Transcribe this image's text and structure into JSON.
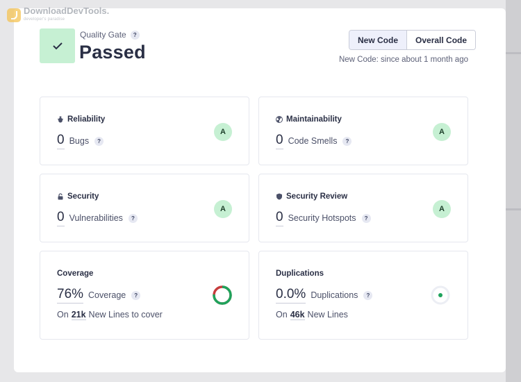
{
  "watermark": {
    "brand": "DownloadDevTools.",
    "tagline": "developer's paradise"
  },
  "quality_gate": {
    "label": "Quality Gate",
    "help": "?",
    "status": "Passed"
  },
  "code_toggle": {
    "options": [
      "New Code",
      "Overall Code"
    ],
    "selected": "New Code"
  },
  "new_code_note": "New Code: since about 1 month ago",
  "metrics": [
    {
      "title": "Reliability",
      "value": "0",
      "label": "Bugs",
      "help": "?",
      "rating": "A"
    },
    {
      "title": "Maintainability",
      "value": "0",
      "label": "Code Smells",
      "help": "?",
      "rating": "A"
    },
    {
      "title": "Security",
      "value": "0",
      "label": "Vulnerabilities",
      "help": "?",
      "rating": "A"
    },
    {
      "title": "Security Review",
      "value": "0",
      "label": "Security Hotspots",
      "help": "?",
      "rating": "A"
    }
  ],
  "coverage": {
    "title": "Coverage",
    "value": "76%",
    "label": "Coverage",
    "help": "?",
    "on": "On",
    "lines": "21k",
    "lines_label": "New Lines to cover",
    "percent": 76
  },
  "duplications": {
    "title": "Duplications",
    "value": "0.0%",
    "label": "Duplications",
    "help": "?",
    "on": "On",
    "lines": "46k",
    "lines_label": "New Lines",
    "percent": 0
  },
  "colors": {
    "pass_green": "#c6f0d3",
    "covered": "#1fa35c",
    "uncovered": "#c63d3d",
    "dup_dot": "#1fa35c"
  }
}
